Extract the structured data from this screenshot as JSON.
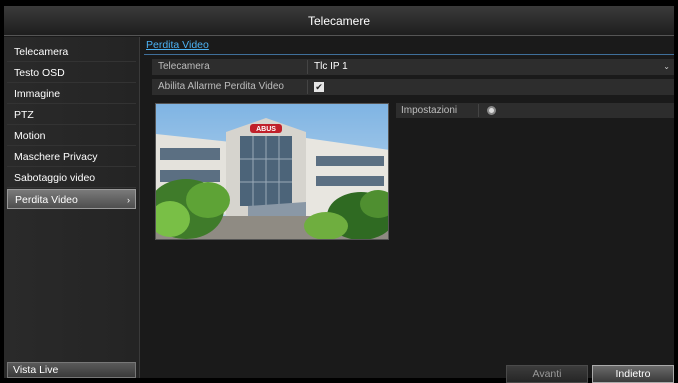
{
  "window": {
    "title": "Telecamere"
  },
  "sidebar": {
    "items": [
      {
        "label": "Telecamera"
      },
      {
        "label": "Testo OSD"
      },
      {
        "label": "Immagine"
      },
      {
        "label": "PTZ"
      },
      {
        "label": "Motion"
      },
      {
        "label": "Maschere Privacy"
      },
      {
        "label": "Sabotaggio video"
      },
      {
        "label": "Perdita Video",
        "active": true
      }
    ],
    "chevron": "›",
    "live_view": "Vista Live"
  },
  "main": {
    "tab": "Perdita Video",
    "camera_label": "Telecamera",
    "camera_value": "Tlc IP 1",
    "dropdown_arrow": "⌄",
    "alarm_label": "Abilita Allarme Perdita Video",
    "alarm_checked": "✔",
    "settings_label": "Impostazioni",
    "preview_sign": "ABUS"
  },
  "buttons": {
    "next": "Avanti",
    "back": "Indietro"
  },
  "colors": {
    "accent": "#4cb3f5",
    "background": "#1a1a1a",
    "sign": "#c0202a"
  },
  "icons": {
    "settings": "gear-icon",
    "check": "check-icon",
    "dropdown": "chevron-down-icon",
    "submenu": "chevron-right-icon"
  }
}
